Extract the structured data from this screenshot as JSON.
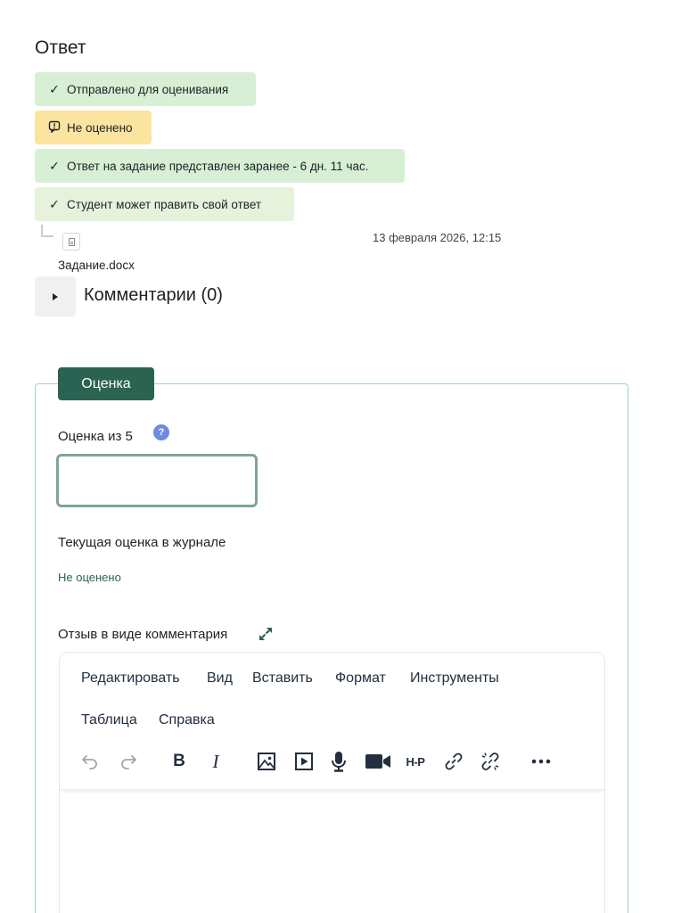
{
  "submission": {
    "title": "Ответ",
    "statuses": [
      {
        "text": "Отправлено для оценивания",
        "icon": "check-icon"
      },
      {
        "text": "Не оценено",
        "icon": "alert-icon"
      },
      {
        "text": "Ответ на задание представлен заранее - 6 дн. 11 час.",
        "icon": "check-icon"
      },
      {
        "text": "Студент может править свой ответ",
        "icon": "check-icon"
      }
    ],
    "file": {
      "name": "Задание.docx",
      "date": "13 февраля 2026, 12:15"
    },
    "comments_label": "Комментарии (0)"
  },
  "grading": {
    "legend": "Оценка",
    "grade_label": "Оценка из 5",
    "grade_value": "",
    "current_label": "Текущая оценка в журнале",
    "current_value": "Не оценено",
    "feedback_label": "Отзыв в виде комментария"
  },
  "editor": {
    "menu": [
      "Редактировать",
      "Вид",
      "Вставить",
      "Формат",
      "Инструменты",
      "Таблица",
      "Справка"
    ],
    "toolbar": [
      "undo",
      "redo",
      "bold",
      "italic",
      "image",
      "media",
      "audio",
      "video",
      "h5p",
      "link",
      "unlink",
      "more"
    ]
  },
  "colors": {
    "primary": "#2a6352",
    "success_bg": "#d7efd5",
    "warning_bg": "#fbe3a0",
    "info_icon": "#6f8be0"
  }
}
